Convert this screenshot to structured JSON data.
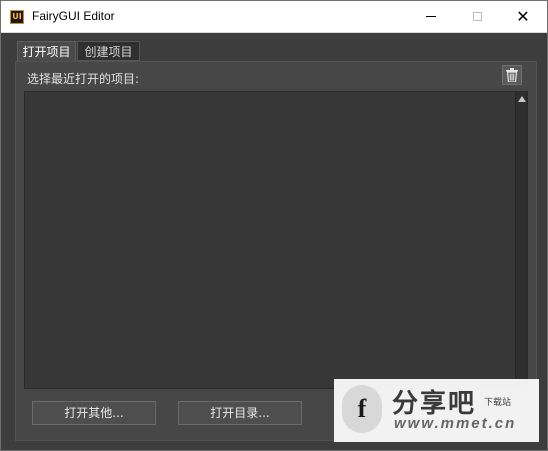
{
  "window": {
    "title": "FairyGUI Editor",
    "icon_text": "UI"
  },
  "tabs": {
    "open": "打开项目",
    "create": "创建项目"
  },
  "open_panel": {
    "list_label": "选择最近打开的项目:"
  },
  "buttons": {
    "open_other": "打开其他...",
    "open_dir": "打开目录..."
  },
  "watermark": {
    "logo_char": "f",
    "title": "分享吧",
    "sub": "下载站",
    "url": "www.mmet.cn"
  },
  "icons": [
    "app-icon",
    "minimize-icon",
    "maximize-icon",
    "close-icon",
    "trash-icon",
    "scroll-up-arrow-icon"
  ],
  "colors": {
    "window_bg": "#3d3d3d",
    "panel_bg": "#474747",
    "list_bg": "#373737",
    "accent_icon": "#ffb23c"
  }
}
